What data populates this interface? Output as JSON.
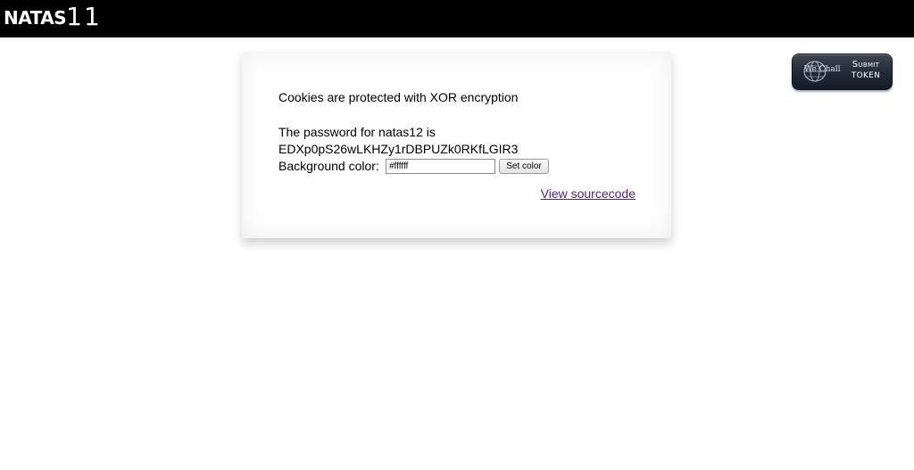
{
  "header": {
    "logo_text": "NATAS",
    "logo_number": "11"
  },
  "submit_token": {
    "wechall_label": "We Chall",
    "line1": "Submit",
    "line2": "TOKEN"
  },
  "main": {
    "message": "Cookies are protected with XOR encryption",
    "password_label": "The password for natas12 is",
    "password_value": "EDXp0pS26wLKHZy1rDBPUZk0RKfLGIR3",
    "bg_color_label": "Background color:",
    "bg_color_value": "#ffffff",
    "set_color_label": "Set color",
    "view_source_label": "View sourcecode"
  },
  "colors": {
    "header_bg": "#000000",
    "link": "#551a8b",
    "page_bg": "#ffffff"
  }
}
